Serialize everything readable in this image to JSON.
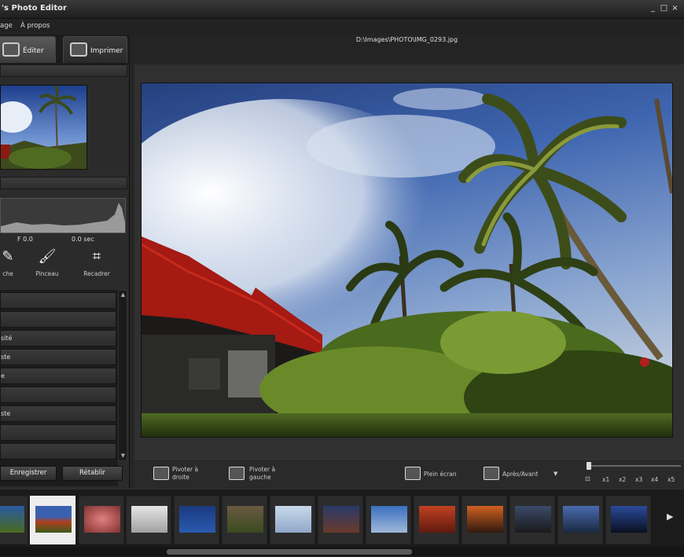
{
  "window": {
    "title": "'s Photo Editor",
    "controls": [
      "_",
      "□",
      "×"
    ]
  },
  "menu": [
    "age",
    "À propos"
  ],
  "tabs": [
    {
      "label": "Éditer",
      "icon": "edit-icon",
      "active": true
    },
    {
      "label": "Imprimer",
      "icon": "printer-icon",
      "active": false
    }
  ],
  "path": "D:\\Images\\PHOTO\\IMG_0293.jpg",
  "exif": {
    "aperture": "F 0.0",
    "exposure": "0.0 sec"
  },
  "tools": [
    {
      "label": "che",
      "icon": "brush-icon"
    },
    {
      "label": "Pinceau",
      "icon": "paintbrush-icon"
    },
    {
      "label": "Recadrer",
      "icon": "crop-icon"
    }
  ],
  "adjustments": [
    "",
    "",
    "sité",
    "ste",
    "e",
    "",
    "ste",
    "",
    ""
  ],
  "buttons": {
    "save": "Enregistrer",
    "restore": "Rétablir"
  },
  "actions": [
    {
      "label": "Pivoter à droite",
      "icon": "rotate-right-icon"
    },
    {
      "label": "Pivoter à gauche",
      "icon": "rotate-left-icon"
    },
    {
      "label": "Plein écran",
      "icon": "fullscreen-icon"
    },
    {
      "label": "Après/Avant",
      "icon": "compare-icon"
    }
  ],
  "zoom": {
    "labels": [
      "x1",
      "x2",
      "x3",
      "x4",
      "x5"
    ],
    "level": 0
  },
  "filmstrip_count": 14,
  "colors": {
    "accent": "#b31e1e",
    "panel": "#2b2b2b"
  }
}
